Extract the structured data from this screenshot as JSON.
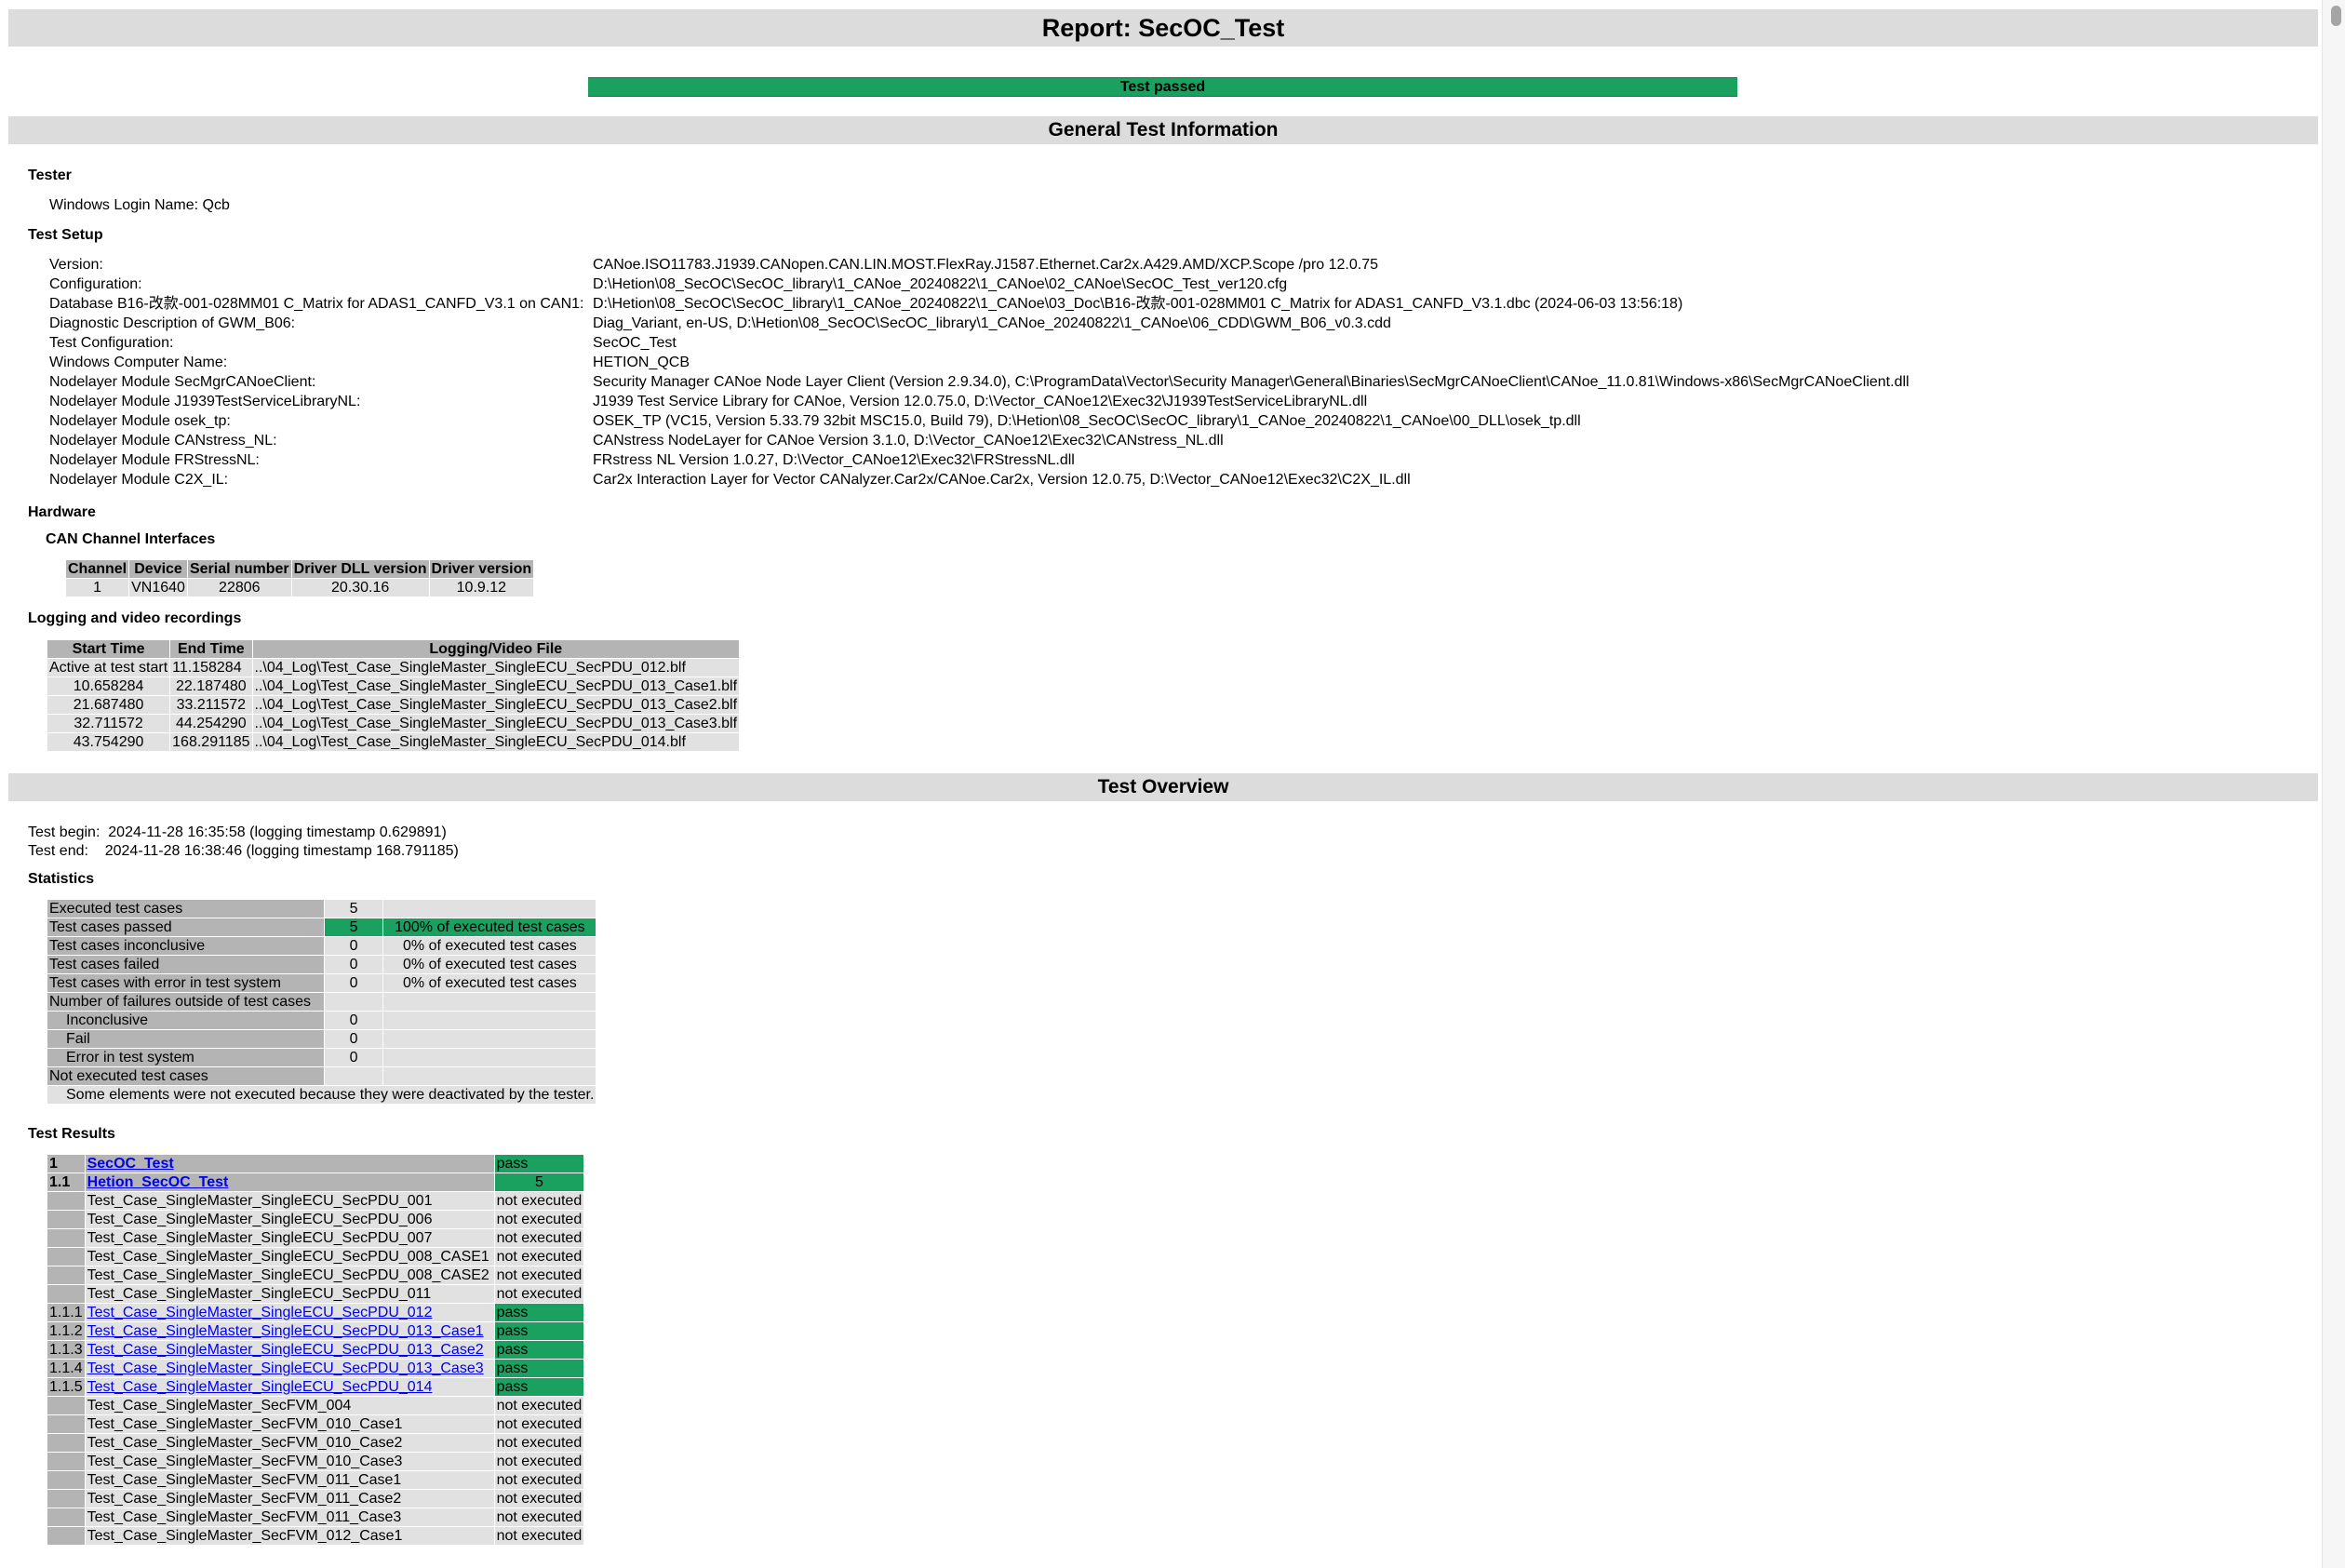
{
  "title": "Report: SecOC_Test",
  "verdict": "Test passed",
  "general": {
    "heading": "General Test Information",
    "tester_heading": "Tester",
    "login_label": "Windows Login Name:",
    "login_value": "Qcb",
    "setup_heading": "Test Setup",
    "setup": [
      {
        "key": "Version:",
        "value": "CANoe.ISO11783.J1939.CANopen.CAN.LIN.MOST.FlexRay.J1587.Ethernet.Car2x.A429.AMD/XCP.Scope /pro 12.0.75"
      },
      {
        "key": "Configuration:",
        "value": "D:\\Hetion\\08_SecOC\\SecOC_library\\1_CANoe_20240822\\1_CANoe\\02_CANoe\\SecOC_Test_ver120.cfg"
      },
      {
        "key": "Database B16-改款-001-028MM01 C_Matrix for ADAS1_CANFD_V3.1 on CAN1:",
        "value": "D:\\Hetion\\08_SecOC\\SecOC_library\\1_CANoe_20240822\\1_CANoe\\03_Doc\\B16-改款-001-028MM01 C_Matrix for ADAS1_CANFD_V3.1.dbc (2024-06-03 13:56:18)"
      },
      {
        "key": "Diagnostic Description of GWM_B06:",
        "value": "Diag_Variant, en-US, D:\\Hetion\\08_SecOC\\SecOC_library\\1_CANoe_20240822\\1_CANoe\\06_CDD\\GWM_B06_v0.3.cdd"
      },
      {
        "key": "Test Configuration:",
        "value": "SecOC_Test"
      },
      {
        "key": "Windows Computer Name:",
        "value": "HETION_QCB"
      },
      {
        "key": "Nodelayer Module SecMgrCANoeClient:",
        "value": "Security Manager CANoe Node Layer Client (Version 2.9.34.0), C:\\ProgramData\\Vector\\Security Manager\\General\\Binaries\\SecMgrCANoeClient\\CANoe_11.0.81\\Windows-x86\\SecMgrCANoeClient.dll"
      },
      {
        "key": "Nodelayer Module J1939TestServiceLibraryNL:",
        "value": "J1939 Test Service Library for CANoe, Version 12.0.75.0, D:\\Vector_CANoe12\\Exec32\\J1939TestServiceLibraryNL.dll"
      },
      {
        "key": "Nodelayer Module osek_tp:",
        "value": "OSEK_TP (VC15, Version 5.33.79 32bit MSC15.0, Build 79), D:\\Hetion\\08_SecOC\\SecOC_library\\1_CANoe_20240822\\1_CANoe\\00_DLL\\osek_tp.dll"
      },
      {
        "key": "Nodelayer Module CANstress_NL:",
        "value": "CANstress NodeLayer for CANoe Version 3.1.0, D:\\Vector_CANoe12\\Exec32\\CANstress_NL.dll"
      },
      {
        "key": "Nodelayer Module FRStressNL:",
        "value": "FRstress NL Version 1.0.27, D:\\Vector_CANoe12\\Exec32\\FRStressNL.dll"
      },
      {
        "key": "Nodelayer Module C2X_IL:",
        "value": "Car2x Interaction Layer for Vector CANalyzer.Car2x/CANoe.Car2x, Version 12.0.75, D:\\Vector_CANoe12\\Exec32\\C2X_IL.dll"
      }
    ],
    "hardware_heading": "Hardware",
    "can_heading": "CAN Channel Interfaces",
    "hw_headers": [
      "Channel",
      "Device",
      "Serial number",
      "Driver DLL version",
      "Driver version"
    ],
    "hw_rows": [
      [
        "1",
        "VN1640",
        "22806",
        "20.30.16",
        "10.9.12"
      ]
    ],
    "logging_heading": "Logging and video recordings",
    "log_headers": [
      "Start Time",
      "End Time",
      "Logging/Video File"
    ],
    "log_rows": [
      [
        "Active at test start",
        "11.158284",
        "..\\04_Log\\Test_Case_SingleMaster_SingleECU_SecPDU_012.blf"
      ],
      [
        "10.658284",
        "22.187480",
        "..\\04_Log\\Test_Case_SingleMaster_SingleECU_SecPDU_013_Case1.blf"
      ],
      [
        "21.687480",
        "33.211572",
        "..\\04_Log\\Test_Case_SingleMaster_SingleECU_SecPDU_013_Case2.blf"
      ],
      [
        "32.711572",
        "44.254290",
        "..\\04_Log\\Test_Case_SingleMaster_SingleECU_SecPDU_013_Case3.blf"
      ],
      [
        "43.754290",
        "168.291185",
        "..\\04_Log\\Test_Case_SingleMaster_SingleECU_SecPDU_014.blf"
      ]
    ]
  },
  "overview": {
    "heading": "Test Overview",
    "begin_label": "Test begin:",
    "begin_value": "2024-11-28 16:35:58  (logging timestamp 0.629891)",
    "end_label": "Test end:",
    "end_value": "2024-11-28 16:38:46  (logging timestamp 168.791185)",
    "stats_heading": "Statistics",
    "stats": {
      "executed_label": "Executed test cases",
      "executed": "5",
      "passed_label": "Test cases passed",
      "passed": "5",
      "passed_pct": "100% of executed test cases",
      "inconclusive_label": "Test cases inconclusive",
      "inconclusive": "0",
      "inconclusive_pct": "0% of executed test cases",
      "failed_label": "Test cases failed",
      "failed": "0",
      "failed_pct": "0% of executed test cases",
      "error_label": "Test cases with error in test system",
      "error": "0",
      "error_pct": "0% of executed test cases",
      "outside_label": "Number of failures outside of test cases",
      "out_inconclusive_label": "Inconclusive",
      "out_inconclusive": "0",
      "out_fail_label": "Fail",
      "out_fail": "0",
      "out_error_label": "Error in test system",
      "out_error": "0",
      "not_executed_label": "Not executed test cases",
      "note": "Some elements were not executed because they were deactivated by the tester."
    },
    "results_heading": "Test Results",
    "results_top": [
      {
        "id": "1",
        "name": "SecOC_Test",
        "status": "pass"
      },
      {
        "id": "1.1",
        "name": "Hetion_SecOC_Test",
        "status": "5"
      }
    ],
    "results": [
      {
        "id": "",
        "name": "Test_Case_SingleMaster_SingleECU_SecPDU_001",
        "status": "not executed"
      },
      {
        "id": "",
        "name": "Test_Case_SingleMaster_SingleECU_SecPDU_006",
        "status": "not executed"
      },
      {
        "id": "",
        "name": "Test_Case_SingleMaster_SingleECU_SecPDU_007",
        "status": "not executed"
      },
      {
        "id": "",
        "name": "Test_Case_SingleMaster_SingleECU_SecPDU_008_CASE1",
        "status": "not executed"
      },
      {
        "id": "",
        "name": "Test_Case_SingleMaster_SingleECU_SecPDU_008_CASE2",
        "status": "not executed"
      },
      {
        "id": "",
        "name": "Test_Case_SingleMaster_SingleECU_SecPDU_011",
        "status": "not executed"
      },
      {
        "id": "1.1.1",
        "name": "Test_Case_SingleMaster_SingleECU_SecPDU_012",
        "status": "pass",
        "link": true
      },
      {
        "id": "1.1.2",
        "name": "Test_Case_SingleMaster_SingleECU_SecPDU_013_Case1",
        "status": "pass",
        "link": true
      },
      {
        "id": "1.1.3",
        "name": "Test_Case_SingleMaster_SingleECU_SecPDU_013_Case2",
        "status": "pass",
        "link": true
      },
      {
        "id": "1.1.4",
        "name": "Test_Case_SingleMaster_SingleECU_SecPDU_013_Case3",
        "status": "pass",
        "link": true
      },
      {
        "id": "1.1.5",
        "name": "Test_Case_SingleMaster_SingleECU_SecPDU_014",
        "status": "pass",
        "link": true
      },
      {
        "id": "",
        "name": "Test_Case_SingleMaster_SecFVM_004",
        "status": "not executed"
      },
      {
        "id": "",
        "name": "Test_Case_SingleMaster_SecFVM_010_Case1",
        "status": "not executed"
      },
      {
        "id": "",
        "name": "Test_Case_SingleMaster_SecFVM_010_Case2",
        "status": "not executed"
      },
      {
        "id": "",
        "name": "Test_Case_SingleMaster_SecFVM_010_Case3",
        "status": "not executed"
      },
      {
        "id": "",
        "name": "Test_Case_SingleMaster_SecFVM_011_Case1",
        "status": "not executed"
      },
      {
        "id": "",
        "name": "Test_Case_SingleMaster_SecFVM_011_Case2",
        "status": "not executed"
      },
      {
        "id": "",
        "name": "Test_Case_SingleMaster_SecFVM_011_Case3",
        "status": "not executed"
      },
      {
        "id": "",
        "name": "Test_Case_SingleMaster_SecFVM_012_Case1",
        "status": "not executed"
      }
    ]
  },
  "colors": {
    "pass": "#1aa05f",
    "header_bar": "#dcdcdc",
    "cell": "#e1e1e1",
    "label_cell": "#b4b4b4",
    "link": "#0000ee"
  }
}
